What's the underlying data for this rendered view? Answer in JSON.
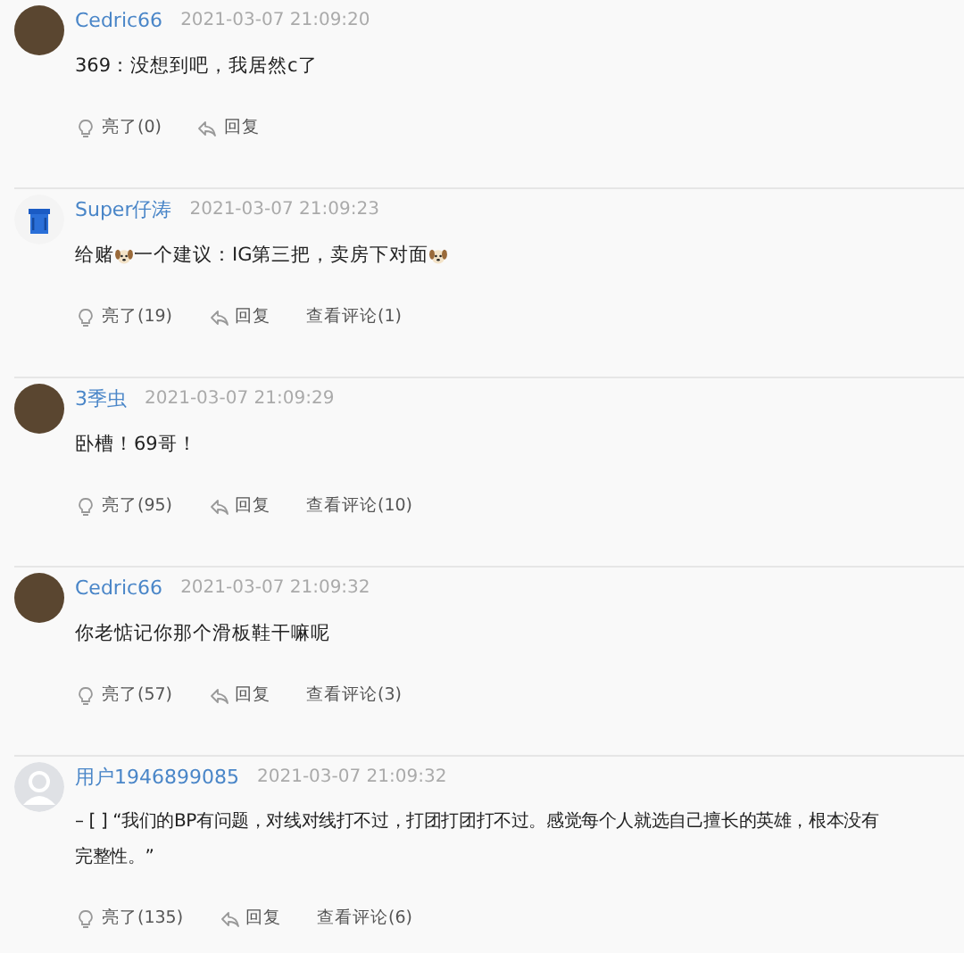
{
  "comments": [
    {
      "avatar": {
        "kind": "photo"
      },
      "user": "Cedric66",
      "time": "2021-03-07 21:09:20",
      "lines": [
        [
          {
            "kind": "text",
            "text": "369：没想到吧，我居然c了"
          }
        ]
      ],
      "likes": "亮了(0)",
      "reply": "回复"
    },
    {
      "avatar": {
        "kind": "bin"
      },
      "user": "Super仔涛",
      "time": "2021-03-07 21:09:23",
      "lines": [
        [
          {
            "kind": "text",
            "text": "给赌"
          },
          {
            "kind": "emoji"
          },
          {
            "kind": "text",
            "text": "一个建议：IG第三把，卖房下对面"
          },
          {
            "kind": "emoji"
          }
        ]
      ],
      "likes": "亮了(19)",
      "reply": "回复",
      "view": "查看评论(1)"
    },
    {
      "avatar": {
        "kind": "photo"
      },
      "user": "3季虫",
      "time": "2021-03-07 21:09:29",
      "lines": [
        [
          {
            "kind": "text",
            "text": "卧槽！69哥！"
          }
        ]
      ],
      "likes": "亮了(95)",
      "reply": "回复",
      "view": "查看评论(10)"
    },
    {
      "avatar": {
        "kind": "photo"
      },
      "user": "Cedric66",
      "time": "2021-03-07 21:09:32",
      "lines": [
        [
          {
            "kind": "text",
            "text": "你老惦记你那个滑板鞋干嘛呢"
          }
        ]
      ],
      "likes": "亮了(57)",
      "reply": "回复",
      "view": "查看评论(3)"
    },
    {
      "avatar": {
        "kind": "default"
      },
      "user": "用户1946899085",
      "time": "2021-03-07 21:09:32",
      "lines": [
        [
          {
            "kind": "text",
            "text": "– [ ] “我们的BP有问题，对线对线打不过，打团打团打不过。感觉每个人就选自己擅长的英雄，根本没有"
          }
        ],
        [
          {
            "kind": "text",
            "text": "完整性。”"
          }
        ]
      ],
      "likes": "亮了(135)",
      "reply": "回复",
      "view": "查看评论(6)"
    }
  ]
}
